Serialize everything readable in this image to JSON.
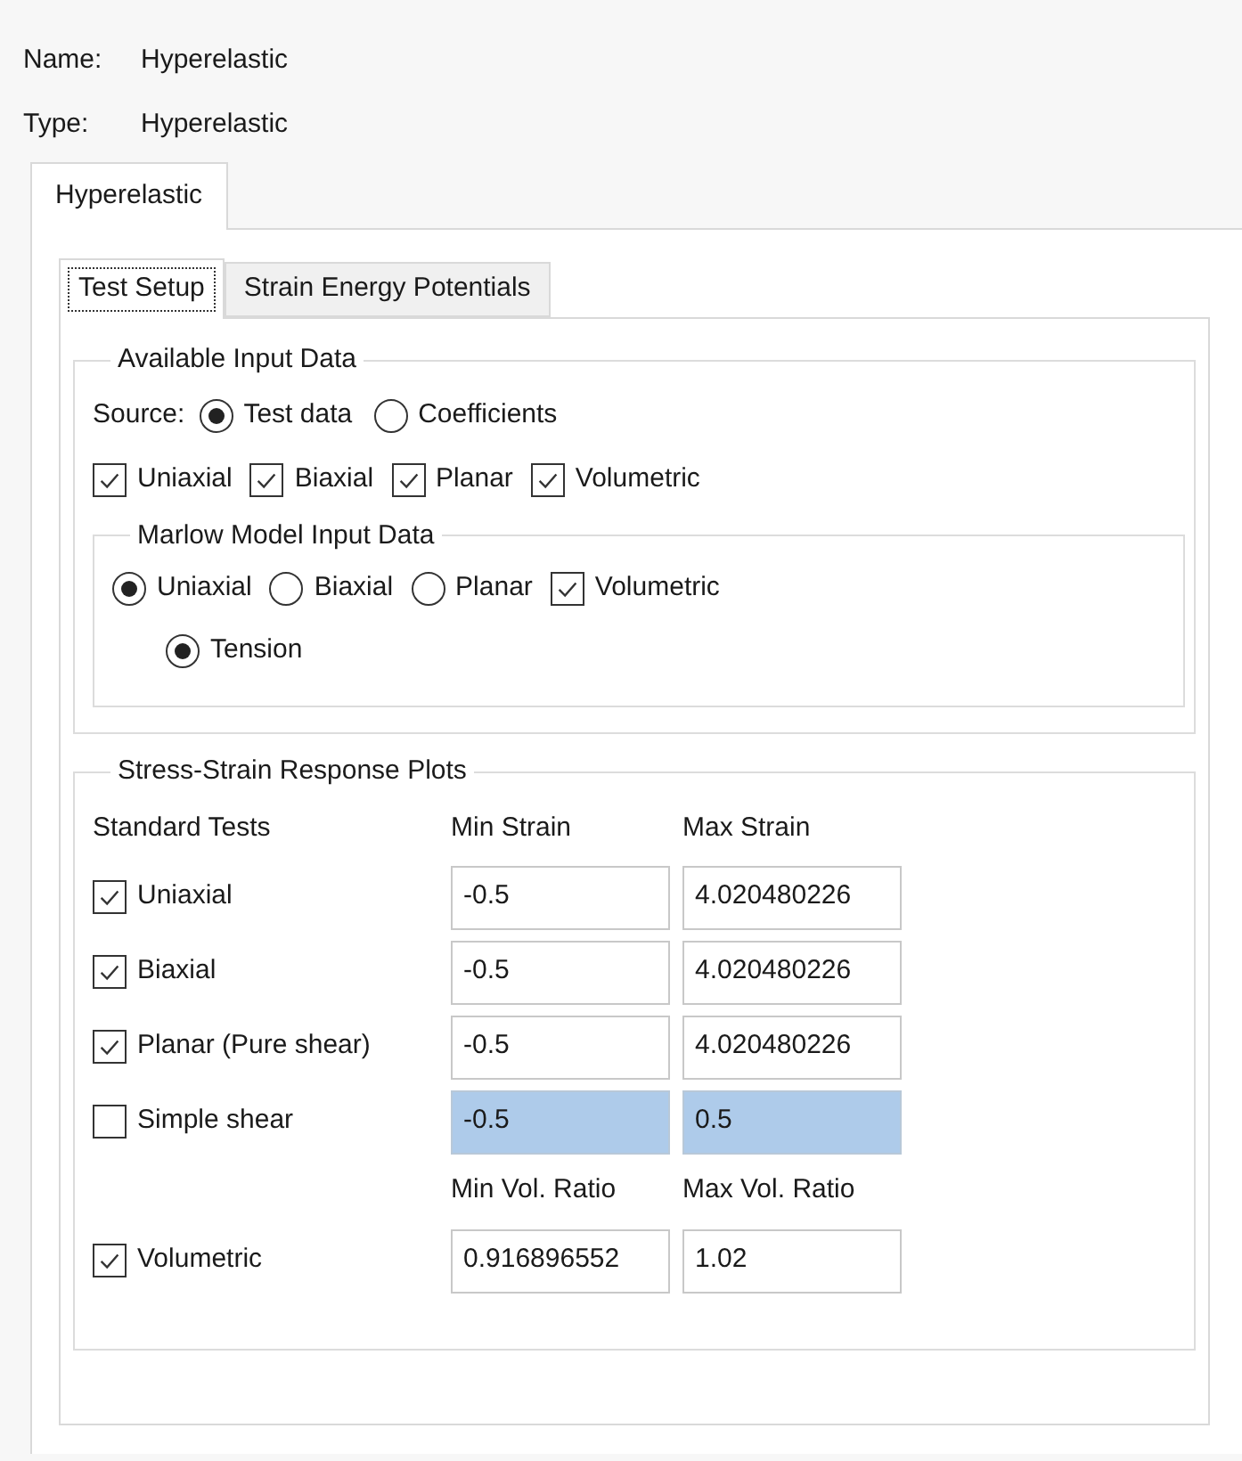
{
  "fields": [
    {
      "label": "Name:",
      "value": "Hyperelastic"
    },
    {
      "label": "Type:",
      "value": "Hyperelastic"
    }
  ],
  "outer_tabs": [
    {
      "label": "Hyperelastic",
      "selected": true
    }
  ],
  "inner_tabs": [
    {
      "label": "Test Setup",
      "selected": true
    },
    {
      "label": "Strain Energy Potentials",
      "selected": false
    }
  ],
  "available_input": {
    "title": "Available Input Data",
    "source_label": "Source:",
    "source_options": [
      {
        "label": "Test data",
        "selected": true
      },
      {
        "label": "Coefficients",
        "selected": false
      }
    ],
    "data_types": [
      {
        "label": "Uniaxial",
        "checked": true
      },
      {
        "label": "Biaxial",
        "checked": true
      },
      {
        "label": "Planar",
        "checked": true
      },
      {
        "label": "Volumetric",
        "checked": true
      }
    ],
    "marlow": {
      "title": "Marlow Model Input Data",
      "options": [
        {
          "kind": "radio",
          "label": "Uniaxial",
          "selected": true
        },
        {
          "kind": "radio",
          "label": "Biaxial",
          "selected": false
        },
        {
          "kind": "radio",
          "label": "Planar",
          "selected": false
        },
        {
          "kind": "checkbox",
          "label": "Volumetric",
          "checked": true
        }
      ],
      "sub_options": [
        {
          "label": "Tension",
          "selected": true
        }
      ]
    }
  },
  "plots": {
    "title": "Stress-Strain Response Plots",
    "columns": [
      "Standard Tests",
      "Min Strain",
      "Max Strain"
    ],
    "tests": [
      {
        "label": "Uniaxial",
        "checked": true,
        "disabled": false,
        "min": "-0.5",
        "max": "4.020480226"
      },
      {
        "label": "Biaxial",
        "checked": true,
        "disabled": false,
        "min": "-0.5",
        "max": "4.020480226"
      },
      {
        "label": "Planar (Pure shear)",
        "checked": true,
        "disabled": false,
        "min": "-0.5",
        "max": "4.020480226"
      },
      {
        "label": "Simple shear",
        "checked": false,
        "disabled": true,
        "min": "-0.5",
        "max": "0.5"
      }
    ],
    "volumetric_columns": [
      "Min Vol. Ratio",
      "Max Vol. Ratio"
    ],
    "volumetric": {
      "label": "Volumetric",
      "checked": true,
      "disabled": false,
      "min": "0.916896552",
      "max": "1.02"
    }
  }
}
